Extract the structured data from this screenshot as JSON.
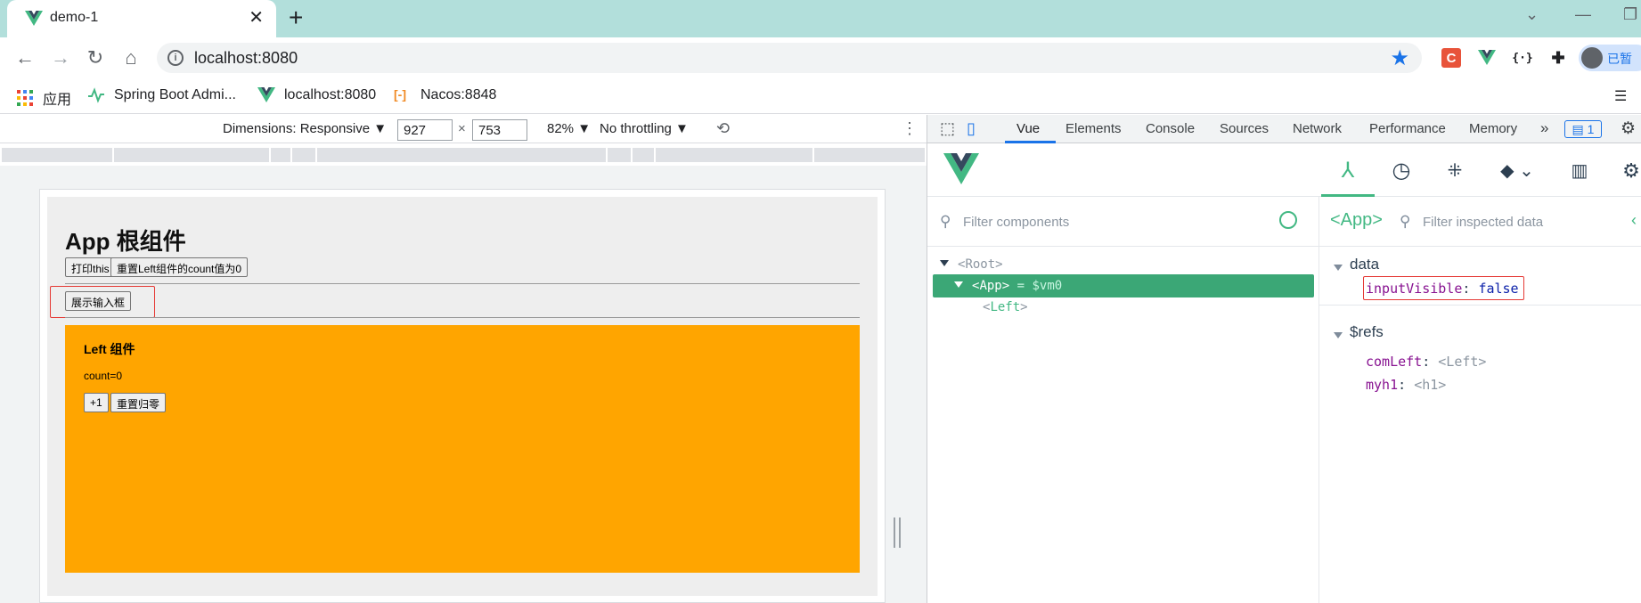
{
  "browser": {
    "tab_title": "demo-1",
    "url": "localhost:8080",
    "profile_label": "已暂",
    "bookmarks": [
      {
        "label": "应用",
        "icon": "apps-grid-icon"
      },
      {
        "label": "Spring Boot Admi...",
        "icon": "spring-boot-admin-icon"
      },
      {
        "label": "localhost:8080",
        "icon": "vue-logo-icon"
      },
      {
        "label": "Nacos:8848",
        "icon": "nacos-icon"
      }
    ],
    "extensions": [
      "c-extension-icon",
      "vue-devtools-extension-icon",
      "json-extension-icon",
      "puzzle-extensions-icon"
    ]
  },
  "device_toolbar": {
    "dimensions_label": "Dimensions: Responsive",
    "width": "927",
    "height": "753",
    "times": "×",
    "zoom": "82%",
    "throttling": "No throttling"
  },
  "page": {
    "app_title": "App 根组件",
    "print_this_label": "打印this",
    "reset_left_label": "重置Left组件的count值为0",
    "show_input_label": "展示输入框",
    "left_component": {
      "title": "Left 组件",
      "count_text": "count=0",
      "increment_label": "+1",
      "reset_label": "重置归零"
    },
    "colors": {
      "left_bg": "#ffa500",
      "app_bg": "#eeeeee"
    }
  },
  "devtools": {
    "tabs": [
      "Vue",
      "Elements",
      "Console",
      "Sources",
      "Network",
      "Performance",
      "Memory"
    ],
    "active_tab": "Vue",
    "more_tabs": "»",
    "message_count": "1",
    "vue_tools": [
      "components-tree-icon",
      "timeline-icon",
      "routes-icon",
      "router-icon",
      "chart-icon",
      "settings-icon"
    ],
    "components": {
      "filter_placeholder": "Filter components",
      "tree": [
        {
          "name": "Root",
          "open": "<",
          "close": ">"
        },
        {
          "name": "App",
          "open": "<",
          "close": ">",
          "suffix": " = $vm0",
          "selected": true
        },
        {
          "name": "Left",
          "open": "<",
          "close": ">"
        }
      ]
    },
    "inspector": {
      "component_name": "<App>",
      "filter_placeholder": "Filter inspected data",
      "data_title": "data",
      "data_props": [
        {
          "key": "inputVisible",
          "value": "false"
        }
      ],
      "refs_title": "$refs",
      "refs_props": [
        {
          "key": "comLeft",
          "value": "<Left>"
        },
        {
          "key": "myh1",
          "value": "<h1>"
        }
      ]
    },
    "colors": {
      "vue_green": "#42b883",
      "selected_row": "#3ba776",
      "highlight_red": "#e53935"
    }
  }
}
